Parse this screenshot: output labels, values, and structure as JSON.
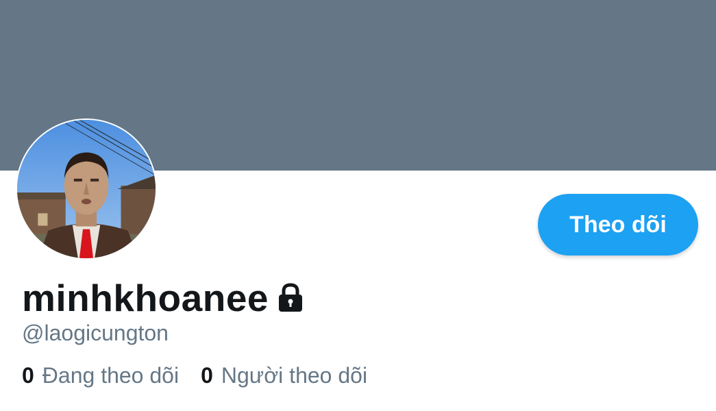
{
  "colors": {
    "banner": "#657786",
    "accent": "#1da1f2",
    "text_primary": "#14171a",
    "text_secondary": "#657786"
  },
  "profile": {
    "display_name": "minhkhoanee",
    "handle": "@laogicungton",
    "protected_icon": "lock-icon",
    "avatar": "profile-photo"
  },
  "actions": {
    "follow_label": "Theo dõi"
  },
  "stats": {
    "following_count": "0",
    "following_label": "Đang theo dõi",
    "followers_count": "0",
    "followers_label": "Người theo dõi"
  }
}
